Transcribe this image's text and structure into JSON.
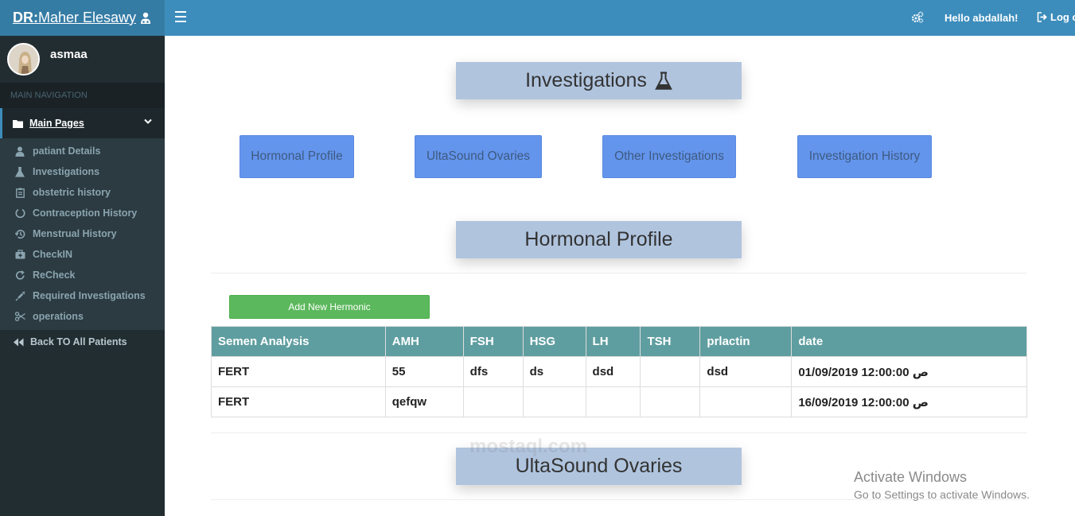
{
  "header": {
    "brand_prefix": "DR:",
    "brand_name": "Maher Elesawy",
    "greeting": "Hello abdallah!",
    "logout_label": "Log out"
  },
  "sidebar": {
    "user_name": "asmaa",
    "nav_header": "MAIN NAVIGATION",
    "main_pages_label": "Main Pages",
    "items": [
      {
        "label": "patiant Details",
        "icon": "user-icon"
      },
      {
        "label": "Investigations",
        "icon": "flask-icon"
      },
      {
        "label": "obstetric history",
        "icon": "clipboard-icon"
      },
      {
        "label": "Contraception History",
        "icon": "circle-notch-icon"
      },
      {
        "label": "Menstrual History",
        "icon": "history-icon"
      },
      {
        "label": "CheckIN",
        "icon": "briefcase-medical-icon"
      },
      {
        "label": "ReCheck",
        "icon": "redo-icon"
      },
      {
        "label": "Required Investigations",
        "icon": "syringe-icon"
      },
      {
        "label": "operations",
        "icon": "scissors-icon"
      }
    ],
    "back_label": "Back TO All Patients"
  },
  "main": {
    "investigations_title": "Investigations",
    "buttons": [
      "Hormonal Profile",
      "UltaSound Ovaries",
      "Other Investigations",
      "Investigation History"
    ],
    "hormonal_title": "Hormonal Profile",
    "add_button": "Add New Hermonic",
    "table": {
      "headers": [
        "Semen Analysis",
        "AMH",
        "FSH",
        "HSG",
        "LH",
        "TSH",
        "prlactin",
        "date"
      ],
      "rows": [
        [
          "FERT",
          "55",
          "dfs",
          "ds",
          "dsd",
          "",
          "dsd",
          "01/09/2019 12:00:00 ص"
        ],
        [
          "FERT",
          "qefqw",
          "",
          "",
          "",
          "",
          "",
          "16/09/2019 12:00:00 ص"
        ]
      ]
    },
    "ultrasound_title": "UltaSound Ovaries"
  },
  "overlay": {
    "watermark": "mostaql.com",
    "activate_title": "Activate Windows",
    "activate_sub": "Go to Settings to activate Windows."
  },
  "colors": {
    "header_bg": "#3c8dbc",
    "logo_bg": "#357ca5",
    "sidebar_bg": "#222d32",
    "title_bg": "#b0c4de",
    "button_blue": "#6495ed",
    "button_green": "#5cb85c",
    "table_header": "#5f9ea0"
  }
}
